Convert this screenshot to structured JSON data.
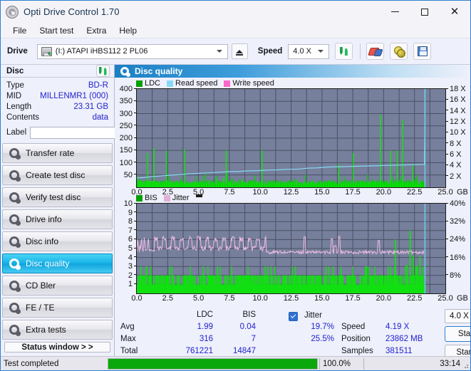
{
  "window": {
    "title": "Opti Drive Control 1.70",
    "icon": "disc-icon",
    "minimize": "minimize-icon",
    "maximize": "maximize-icon",
    "close": "close-icon"
  },
  "menu": {
    "items": [
      "File",
      "Start test",
      "Extra",
      "Help"
    ]
  },
  "toolbar": {
    "drive_label": "Drive",
    "drive_value": "(I:)   ATAPI iHBS112   2 PL06",
    "eject": "eject-icon",
    "speed_label": "Speed",
    "speed_value": "4.0 X",
    "refresh": "refresh-icon",
    "erase": "erase-icon",
    "gold": "gold-disc-icon",
    "save": "save-icon"
  },
  "disc": {
    "title": "Disc",
    "refresh": "refresh-icon",
    "rows": [
      {
        "key": "Type",
        "value": "BD-R"
      },
      {
        "key": "MID",
        "value": "MILLENMR1 (000)"
      },
      {
        "key": "Length",
        "value": "23.31 GB"
      },
      {
        "key": "Contents",
        "value": "data"
      }
    ],
    "label_key": "Label",
    "label_value": "",
    "label_placeholder": ""
  },
  "nav": {
    "items": [
      {
        "label": "Transfer rate",
        "active": false
      },
      {
        "label": "Create test disc",
        "active": false
      },
      {
        "label": "Verify test disc",
        "active": false
      },
      {
        "label": "Drive info",
        "active": false
      },
      {
        "label": "Disc info",
        "active": false
      },
      {
        "label": "Disc quality",
        "active": true
      },
      {
        "label": "CD Bler",
        "active": false
      },
      {
        "label": "FE / TE",
        "active": false
      },
      {
        "label": "Extra tests",
        "active": false
      }
    ],
    "status_window": "Status window > >"
  },
  "panel": {
    "title": "Disc quality"
  },
  "chart_data": [
    {
      "type": "line",
      "id": "ldc-chart",
      "title": "",
      "legend": [
        {
          "label": "LDC",
          "color": "#00a000"
        },
        {
          "label": "Read speed",
          "color": "#7fd4f0"
        },
        {
          "label": "Write speed",
          "color": "#ff66cc"
        }
      ],
      "xlabel": "GB",
      "x_ticks": [
        "0.0",
        "2.5",
        "5.0",
        "7.5",
        "10.0",
        "12.5",
        "15.0",
        "17.5",
        "20.0",
        "22.5",
        "25.0"
      ],
      "xlim": [
        0,
        25
      ],
      "ylabel": "",
      "y_ticks": [
        "50",
        "100",
        "150",
        "200",
        "250",
        "300",
        "350",
        "400"
      ],
      "ylim": [
        0,
        400
      ],
      "y2_ticks": [
        "2 X",
        "4 X",
        "6 X",
        "8 X",
        "10 X",
        "12 X",
        "14 X",
        "16 X",
        "18 X"
      ],
      "y2lim": [
        0,
        18
      ],
      "grid": true,
      "series": [
        {
          "name": "LDC",
          "color": "#00c000",
          "type": "spikes",
          "x": [
            0.1,
            0.25,
            0.4,
            0.55,
            0.7,
            0.82,
            0.95,
            1.05,
            1.2,
            1.35,
            1.5,
            1.62,
            1.75,
            1.9,
            2.05,
            2.2,
            2.35,
            2.5,
            2.62,
            2.75,
            2.9,
            3.05,
            3.2,
            3.35,
            3.5,
            3.65,
            3.8,
            3.95,
            4.1,
            4.25,
            4.4,
            4.55,
            4.7,
            4.85,
            5.0,
            5.2,
            5.4,
            5.6,
            5.8,
            6.0,
            6.2,
            6.4,
            6.6,
            6.8,
            7.0,
            7.2,
            7.4,
            7.55,
            7.7,
            7.9,
            8.1,
            8.3,
            8.5,
            8.7,
            8.9,
            9.1,
            9.3,
            9.5,
            9.7,
            9.9,
            10.1,
            10.3,
            10.5,
            10.7,
            10.9,
            11.1,
            11.3,
            11.5,
            11.7,
            11.9,
            12.1,
            12.3,
            12.5,
            12.7,
            12.9,
            13.1,
            13.3,
            13.5,
            13.7,
            13.9,
            14.1,
            14.3,
            14.5,
            14.7,
            14.9,
            15.1,
            15.3,
            15.5,
            15.7,
            15.9,
            16.1,
            16.3,
            16.5,
            16.7,
            16.9,
            17.1,
            17.3,
            17.5,
            17.7,
            17.9,
            18.1,
            18.3,
            18.5,
            18.7,
            18.9,
            19.1,
            19.3,
            19.5,
            19.7,
            19.9,
            20.1,
            20.3,
            20.5,
            20.7,
            20.9,
            21.1,
            21.3,
            21.5,
            21.7,
            21.9,
            22.1,
            22.3,
            22.5,
            22.7,
            22.9,
            23.1,
            23.3
          ],
          "values": [
            30,
            28,
            22,
            25,
            20,
            140,
            24,
            28,
            26,
            160,
            22,
            20,
            24,
            18,
            20,
            22,
            150,
            22,
            20,
            24,
            18,
            20,
            24,
            20,
            18,
            22,
            155,
            20,
            18,
            22,
            20,
            18,
            24,
            18,
            20,
            22,
            18,
            20,
            26,
            18,
            20,
            34,
            20,
            18,
            40,
            150,
            20,
            22,
            18,
            26,
            20,
            18,
            30,
            22,
            20,
            18,
            24,
            20,
            26,
            20,
            150,
            20,
            18,
            22,
            20,
            18,
            24,
            20,
            18,
            26,
            20,
            18,
            22,
            20,
            28,
            20,
            18,
            24,
            20,
            18,
            22,
            28,
            20,
            18,
            24,
            20,
            18,
            26,
            20,
            18,
            22,
            95,
            20,
            18,
            24,
            20,
            18,
            140,
            20,
            18,
            24,
            20,
            18,
            22,
            20,
            18,
            26,
            20,
            295,
            20,
            18,
            24,
            150,
            18,
            22,
            150,
            20,
            275,
            20,
            18,
            22,
            95,
            18,
            22,
            30
          ]
        },
        {
          "name": "Read speed",
          "color": "#86d9f5",
          "type": "line",
          "x": [
            0.0,
            0.6,
            1.2,
            1.8,
            2.6,
            3.4,
            4.2,
            5.0,
            5.8,
            6.6,
            7.4,
            8.2,
            9.0,
            9.8,
            10.6,
            11.4,
            12.2,
            13.0,
            13.8,
            14.6,
            15.4,
            16.2,
            17.0,
            17.8,
            18.6,
            19.4,
            20.2,
            21.0,
            21.8,
            22.6,
            23.3,
            23.35,
            23.35
          ],
          "values": [
            1.72,
            1.78,
            1.95,
            2.05,
            2.2,
            2.3,
            2.45,
            2.55,
            2.65,
            2.75,
            2.85,
            2.9,
            3.0,
            3.05,
            3.15,
            3.2,
            3.3,
            3.3,
            3.5,
            3.55,
            3.7,
            3.75,
            3.8,
            3.85,
            3.9,
            3.95,
            4.0,
            4.05,
            4.1,
            4.15,
            4.2,
            12.0,
            18.0
          ]
        }
      ]
    },
    {
      "type": "line",
      "id": "bis-chart",
      "title": "",
      "legend": [
        {
          "label": "BIS",
          "color": "#00a000"
        },
        {
          "label": "Jitter",
          "color": "#e0b0d8"
        }
      ],
      "xlabel": "GB",
      "x_ticks": [
        "0.0",
        "2.5",
        "5.0",
        "7.5",
        "10.0",
        "12.5",
        "15.0",
        "17.5",
        "20.0",
        "22.5",
        "25.0"
      ],
      "xlim": [
        0,
        25
      ],
      "y_ticks": [
        "1",
        "2",
        "3",
        "4",
        "5",
        "6",
        "7",
        "8",
        "9",
        "10"
      ],
      "ylim": [
        0,
        10
      ],
      "y2_ticks": [
        "8%",
        "16%",
        "24%",
        "32%",
        "40%"
      ],
      "y2lim": [
        0,
        40
      ],
      "grid": true,
      "series": [
        {
          "name": "BIS",
          "color": "#00c000",
          "type": "spikes",
          "baseline": 1.0
        },
        {
          "name": "Jitter",
          "color": "#e7b8df",
          "type": "line",
          "avg_before_10_5": 5.3,
          "avg_after_10_5": 4.6
        }
      ]
    }
  ],
  "stats": {
    "headers": {
      "ldc": "LDC",
      "bis": "BIS",
      "jitter": "Jitter"
    },
    "rows": [
      {
        "label": "Avg",
        "ldc": "1.99",
        "bis": "0.04",
        "jitter": "19.7%"
      },
      {
        "label": "Max",
        "ldc": "316",
        "bis": "7",
        "jitter": "25.5%"
      },
      {
        "label": "Total",
        "ldc": "761221",
        "bis": "14847",
        "jitter": ""
      }
    ],
    "jitter_checked": true,
    "info": [
      {
        "key": "Speed",
        "value": "4.19 X"
      },
      {
        "key": "Position",
        "value": "23862 MB"
      },
      {
        "key": "Samples",
        "value": "381511"
      }
    ],
    "speed_select": "4.0 X",
    "start_full": "Start full",
    "start_part": "Start part"
  },
  "statusbar": {
    "text": "Test completed",
    "percent": "100.0%",
    "progress": 100,
    "time": "33:14"
  }
}
